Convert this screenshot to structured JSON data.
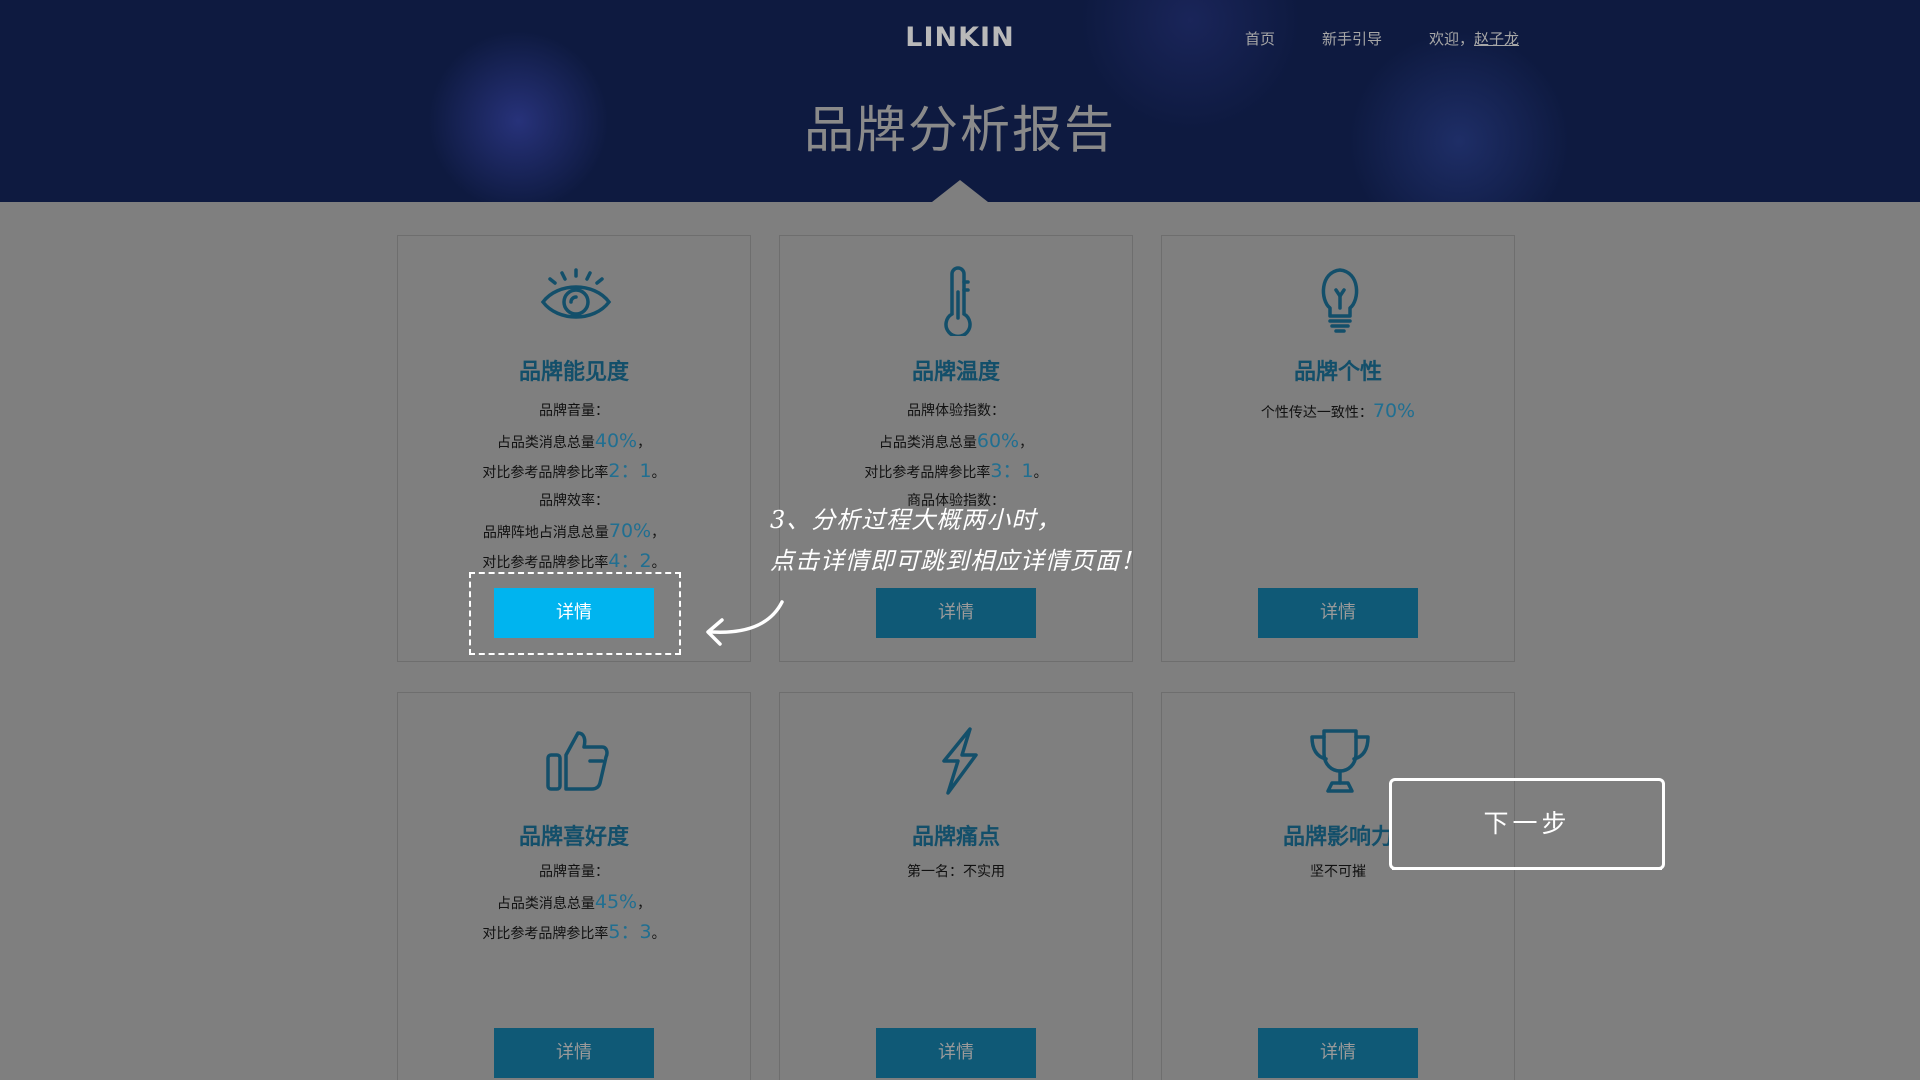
{
  "header": {
    "logo": "LINKIN",
    "nav": {
      "home": "首页",
      "guide": "新手引导",
      "welcome": "欢迎，",
      "user": "赵子龙"
    },
    "title": "品牌分析报告"
  },
  "cards": [
    {
      "title": "品牌能见度",
      "icon": "eye-icon",
      "lines": [
        {
          "text": "品牌音量：",
          "value": ""
        },
        {
          "text": "占品类消息总量",
          "value": "40%",
          "suffix": "，"
        },
        {
          "text": "对比参考品牌参比率",
          "value": "2：1",
          "suffix": "。"
        },
        {
          "text": "品牌效率：",
          "value": ""
        },
        {
          "text": "品牌阵地占消息总量",
          "value": "70%",
          "suffix": "，"
        },
        {
          "text": "对比参考品牌参比率",
          "value": "4：2",
          "suffix": "。"
        }
      ],
      "button": "详情"
    },
    {
      "title": "品牌温度",
      "icon": "thermometer-icon",
      "lines": [
        {
          "text": "品牌体验指数：",
          "value": ""
        },
        {
          "text": "占品类消息总量",
          "value": "60%",
          "suffix": "，"
        },
        {
          "text": "对比参考品牌参比率",
          "value": "3：1",
          "suffix": "。"
        },
        {
          "text": "商品体验指数：",
          "value": ""
        }
      ],
      "button": "详情"
    },
    {
      "title": "品牌个性",
      "icon": "lightbulb-icon",
      "lines": [
        {
          "text": "个性传达一致性：",
          "value": "70%",
          "suffix": ""
        }
      ],
      "button": "详情"
    },
    {
      "title": "品牌喜好度",
      "icon": "thumbs-up-icon",
      "lines": [
        {
          "text": "品牌音量：",
          "value": ""
        },
        {
          "text": "占品类消息总量",
          "value": "45%",
          "suffix": "，"
        },
        {
          "text": "对比参考品牌参比率",
          "value": "5：3",
          "suffix": "。"
        }
      ],
      "button": "详情"
    },
    {
      "title": "品牌痛点",
      "icon": "lightning-icon",
      "lines": [
        {
          "text": "第一名：不实用",
          "value": ""
        }
      ],
      "button": "详情"
    },
    {
      "title": "品牌影响力",
      "icon": "trophy-icon",
      "lines": [
        {
          "text": "坚不可摧",
          "value": ""
        }
      ],
      "button": "详情"
    }
  ],
  "tutorial": {
    "tip_line1": "3、分析过程大概两小时，",
    "tip_line2": "点击详情即可跳到相应详情页面！",
    "next_button": "下一步"
  },
  "colors": {
    "header_bg": "#0e1a40",
    "page_overlay": "#7f7f7f",
    "card_title": "#134f6a",
    "button": "#0f5976",
    "button_active": "#00b4ef"
  }
}
